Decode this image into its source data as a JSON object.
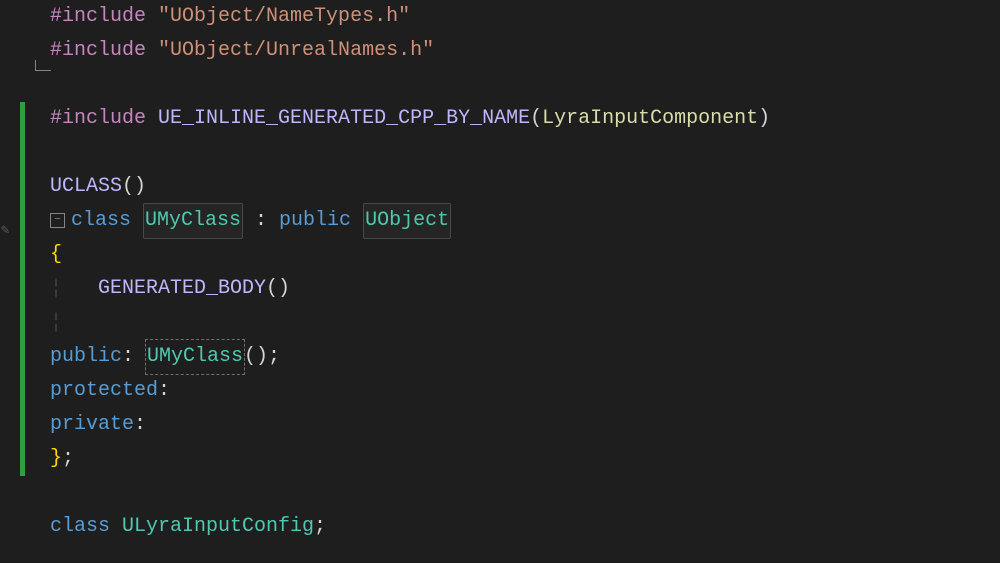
{
  "code": {
    "lines": [
      {
        "indent": 0,
        "parts": [
          {
            "cls": "preproc",
            "t": "#include "
          },
          {
            "cls": "string",
            "t": "\"UObject/NameTypes.h\""
          }
        ],
        "gutter": "|"
      },
      {
        "indent": 0,
        "parts": [
          {
            "cls": "preproc",
            "t": "#include "
          },
          {
            "cls": "string",
            "t": "\"UObject/UnrealNames.h\""
          }
        ],
        "gutter": "L"
      },
      {
        "indent": 0,
        "parts": [
          {
            "cls": "",
            "t": ""
          }
        ]
      },
      {
        "indent": 0,
        "parts": [
          {
            "cls": "preproc",
            "t": "#include "
          },
          {
            "cls": "macro",
            "t": "UE_INLINE_GENERATED_CPP_BY_NAME"
          },
          {
            "cls": "punct",
            "t": "("
          },
          {
            "cls": "idlt",
            "t": "LyraInputComponent"
          },
          {
            "cls": "punct",
            "t": ")"
          }
        ]
      },
      {
        "indent": 0,
        "parts": [
          {
            "cls": "",
            "t": ""
          }
        ]
      },
      {
        "indent": 0,
        "parts": [
          {
            "cls": "macro",
            "t": "UCLASS"
          },
          {
            "cls": "punct",
            "t": "()"
          }
        ]
      },
      {
        "indent": 0,
        "fold": true,
        "parts": [
          {
            "cls": "kw",
            "t": "class "
          },
          {
            "cls": "type hi",
            "t": "UMyClass"
          },
          {
            "cls": "punct",
            "t": " : "
          },
          {
            "cls": "kw",
            "t": "public "
          },
          {
            "cls": "type hi",
            "t": "UObject"
          }
        ]
      },
      {
        "indent": 0,
        "parts": [
          {
            "cls": "brace",
            "t": "{"
          }
        ]
      },
      {
        "indent": 1,
        "parts": [
          {
            "cls": "macro",
            "t": "GENERATED_BODY"
          },
          {
            "cls": "punct",
            "t": "()"
          }
        ]
      },
      {
        "indent": 0,
        "parts": [
          {
            "cls": "",
            "t": ""
          }
        ],
        "guides": true
      },
      {
        "indent": 0,
        "parts": [
          {
            "cls": "kw",
            "t": "public"
          },
          {
            "cls": "punct",
            "t": ": "
          },
          {
            "cls": "type hi2",
            "t": "UMyClass"
          },
          {
            "cls": "punct",
            "t": "();"
          }
        ]
      },
      {
        "indent": 0,
        "parts": [
          {
            "cls": "kw",
            "t": "protected"
          },
          {
            "cls": "punct",
            "t": ":"
          }
        ]
      },
      {
        "indent": 0,
        "parts": [
          {
            "cls": "kw",
            "t": "private"
          },
          {
            "cls": "punct",
            "t": ":"
          }
        ]
      },
      {
        "indent": 0,
        "parts": [
          {
            "cls": "brace",
            "t": "}"
          },
          {
            "cls": "punct",
            "t": ";"
          }
        ]
      },
      {
        "indent": 0,
        "parts": [
          {
            "cls": "",
            "t": ""
          }
        ]
      },
      {
        "indent": 0,
        "parts": [
          {
            "cls": "kw",
            "t": "class "
          },
          {
            "cls": "type",
            "t": "ULyraInputConfig"
          },
          {
            "cls": "punct",
            "t": ";"
          }
        ]
      }
    ]
  },
  "fold_label": "−"
}
